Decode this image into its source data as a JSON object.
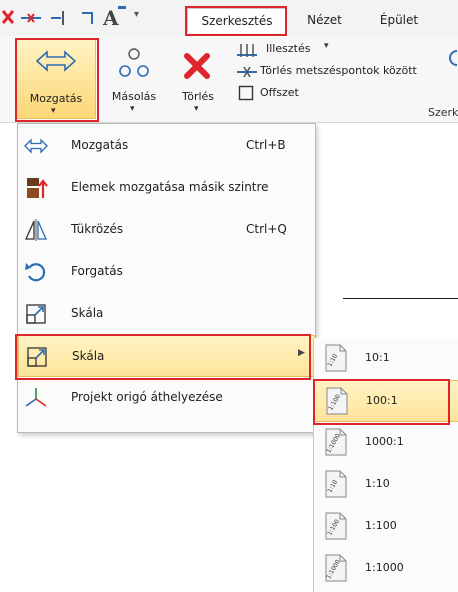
{
  "tabs": {
    "active": "Szerkesztés",
    "view": "Nézet",
    "building": "Épület"
  },
  "ribbon": {
    "move": "Mozgatás",
    "copy": "Másolás",
    "delete": "Törlés",
    "align": "Illesztés",
    "delete_between": "Törlés metszéspontok között",
    "offset": "Offszet",
    "group_label": "Szerk"
  },
  "menu": {
    "items": [
      {
        "label": "Mozgatás",
        "shortcut": "Ctrl+B",
        "icon": "move-arrows-icon"
      },
      {
        "label": "Elemek mozgatása másik szintre",
        "shortcut": "",
        "icon": "move-level-icon"
      },
      {
        "label": "Tükrözés",
        "shortcut": "Ctrl+Q",
        "icon": "mirror-icon"
      },
      {
        "label": "Forgatás",
        "shortcut": "",
        "icon": "rotate-icon"
      },
      {
        "label": "Skála",
        "shortcut": "",
        "icon": "scale-icon"
      },
      {
        "label": "Skála",
        "shortcut": "",
        "icon": "scale-icon",
        "submenu": true
      },
      {
        "label": "Projekt origó áthelyezése",
        "shortcut": "",
        "icon": "origin-axes-icon"
      }
    ]
  },
  "submenu": {
    "items": [
      {
        "label": "10:1",
        "page": "1:10"
      },
      {
        "label": "100:1",
        "page": "1:100"
      },
      {
        "label": "1000:1",
        "page": "1:1000"
      },
      {
        "label": "1:10",
        "page": "1:10"
      },
      {
        "label": "1:100",
        "page": "1:100"
      },
      {
        "label": "1:1000",
        "page": "1:1000"
      }
    ]
  },
  "colors": {
    "highlight": "#fde49a",
    "annotation_red": "#e0242c",
    "icon_blue": "#2e6db4"
  }
}
